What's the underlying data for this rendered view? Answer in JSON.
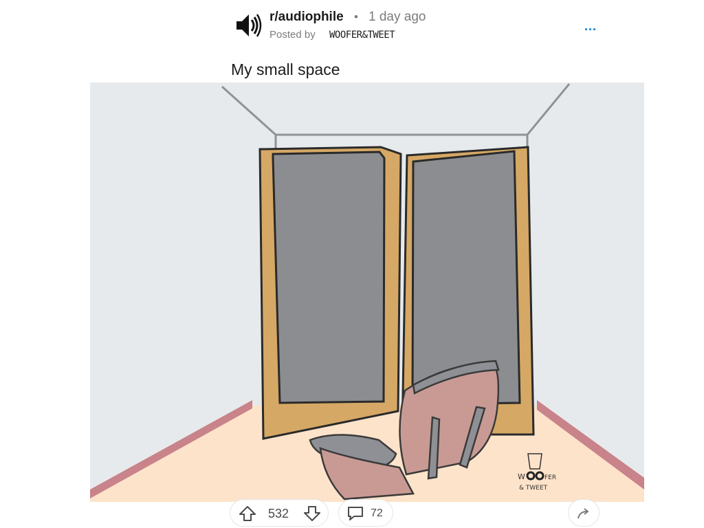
{
  "post": {
    "subreddit": "r/audiophile",
    "separator": "•",
    "time": "1 day ago",
    "posted_by_label": "Posted by",
    "author": "WOOFER&TWEET",
    "more_label": "...",
    "title": "My small space",
    "watermark_line1": "WOOFER",
    "watermark_line2": "& TWEET"
  },
  "actions": {
    "upvotes": "532",
    "comments": "72"
  },
  "icons": {
    "subreddit": "speaker-icon",
    "upvote": "upvote-arrow-icon",
    "downvote": "downvote-arrow-icon",
    "comment": "comment-bubble-icon",
    "share": "share-arrow-icon",
    "more": "more-options-icon"
  },
  "colors": {
    "link_blue": "#0079d3",
    "meta_gray": "#7c7c7c",
    "speaker_wood": "#d6a865",
    "speaker_cloth": "#8c8d90",
    "chair": "#c99a94",
    "floor": "#fde3ca",
    "wall": "#e7eaec"
  }
}
